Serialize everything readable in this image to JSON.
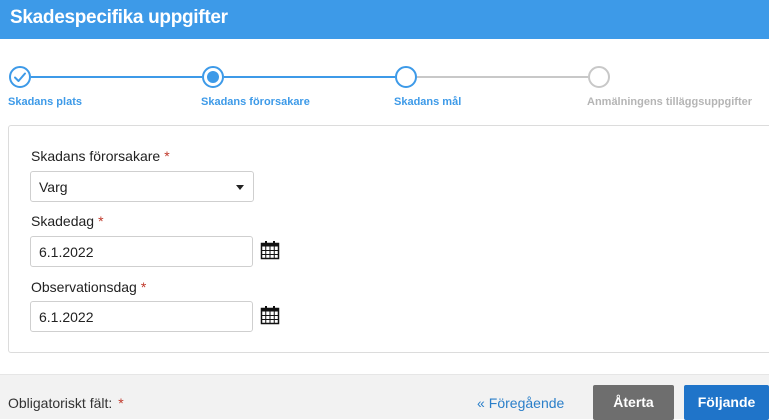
{
  "header": {
    "title": "Skadespecifika uppgifter"
  },
  "stepper": {
    "steps": [
      {
        "label": "Skadans plats",
        "state": "done"
      },
      {
        "label": "Skadans förorsakare",
        "state": "current"
      },
      {
        "label": "Skadans mål",
        "state": "upcoming"
      },
      {
        "label": "Anmälningens tilläggsuppgifter",
        "state": "disabled"
      }
    ],
    "colors": {
      "active": "#3d9ae8",
      "inactive": "#c8c8c8"
    }
  },
  "form": {
    "cause": {
      "label": "Skadans förorsakare",
      "required_mark": "*",
      "value": "Varg"
    },
    "damage_date": {
      "label": "Skadedag",
      "required_mark": "*",
      "value": "6.1.2022"
    },
    "observation_date": {
      "label": "Observationsdag",
      "required_mark": "*",
      "value": "6.1.2022"
    }
  },
  "footer": {
    "required_note": "Obligatoriskt fält:",
    "required_mark": "*",
    "prev_label": "Föregående",
    "reset_label": "Återta",
    "next_label": "Följande"
  },
  "icons": [
    "check-icon",
    "calendar-icon",
    "chevron-double-left-icon",
    "caret-down-icon"
  ]
}
